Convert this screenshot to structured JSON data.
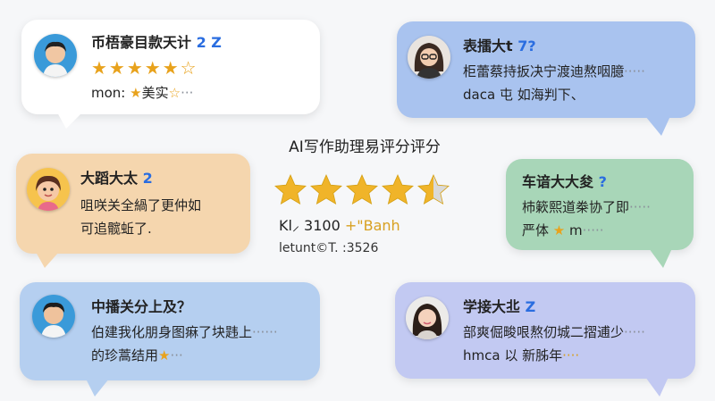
{
  "center": {
    "title": "AI写作助理易评分评分",
    "rating_value": 4.5,
    "stars_total": 5,
    "count_text": "Kl⸝ 3100",
    "count_suffix": "+\"Banh",
    "date_text": "letunt©T. :3526"
  },
  "reviews": [
    {
      "id": "top-left",
      "name": "币梧豪目款天计",
      "name_suffix": "2 Z",
      "line2_stars": "★★★★★☆",
      "line3_prefix": "mon:",
      "line3_star": "★",
      "line3_text": "美实",
      "line3_star2": "☆",
      "line3_dots": "···",
      "bg": "#ffffff"
    },
    {
      "id": "top-right",
      "name": "表擂大t",
      "name_suffix": "7?",
      "line2": "柜蕾蔡持扳决宁渡迪熬咽臆",
      "line2_dots": "·····",
      "line3": "daca 屯 如海判下、",
      "bg": "#a9c3ef"
    },
    {
      "id": "mid-left",
      "name": "大蹈大太",
      "name_suffix": "2",
      "line2": "咀咲关全緺了更仲如",
      "line3": "可追髋蚯了.",
      "bg": "#f5d6ae"
    },
    {
      "id": "mid-right",
      "name": "车谙大大夋",
      "name_suffix": "?",
      "line2": "杮簌熙道桊协了即",
      "line2_dots": "·····",
      "line3_prefix": "严体",
      "line3_star": "★",
      "line3_text": "m",
      "line3_dots": "·····",
      "bg": "#a8d6b8"
    },
    {
      "id": "bottom-left",
      "name": "中播关分上及？",
      "line2": "伯建我化朋身图痳了块韪上",
      "line2_dots": "······",
      "line3": "的珍蒿结用",
      "line3_star": "★",
      "line3_dots": "···",
      "bg": "#b5cff0"
    },
    {
      "id": "bottom-right",
      "name": "学接大丠",
      "name_suffix": "Z",
      "line2": "部爽倔畯哏熬仞城二摺逋少",
      "line2_dots": "·····",
      "line3": "hmca 以 新胏年",
      "line3_dots": "····",
      "bg": "#c2c9f2"
    }
  ]
}
